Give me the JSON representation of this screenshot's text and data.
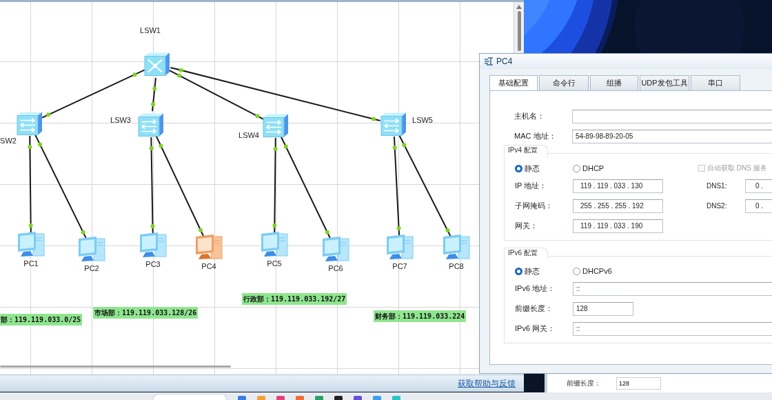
{
  "topology": {
    "switches": [
      {
        "label": "LSW1",
        "kind": "core"
      },
      {
        "label": "SW2",
        "kind": "access"
      },
      {
        "label": "LSW3",
        "kind": "access"
      },
      {
        "label": "LSW4",
        "kind": "access"
      },
      {
        "label": "LSW5",
        "kind": "access"
      }
    ],
    "pcs": [
      {
        "label": "PC1",
        "selected": false
      },
      {
        "label": "PC2",
        "selected": false
      },
      {
        "label": "PC3",
        "selected": false
      },
      {
        "label": "PC4",
        "selected": true
      },
      {
        "label": "PC5",
        "selected": false
      },
      {
        "label": "PC6",
        "selected": false
      },
      {
        "label": "PC7",
        "selected": false
      },
      {
        "label": "PC8",
        "selected": false
      }
    ],
    "subnet_labels": [
      "部：119.119.033.0/25",
      "市场部：119.119.033.128/26",
      "行政部：119.119.033.192/27",
      "财务部：119.119.033.224"
    ]
  },
  "help_link": "获取帮助与反馈",
  "dialog": {
    "title": "PC4",
    "tabs": [
      {
        "label": "基础配置",
        "selected": true
      },
      {
        "label": "命令行",
        "selected": false
      },
      {
        "label": "组播",
        "selected": false
      },
      {
        "label": "UDP发包工具",
        "selected": false
      },
      {
        "label": "串口",
        "selected": false
      }
    ],
    "hostname": {
      "label": "主机名："
    },
    "mac": {
      "label": "MAC 地址：",
      "value": "54-89-98-89-20-05"
    },
    "ipv4": {
      "title": "IPv4 配置",
      "modes": [
        {
          "label": "静态",
          "selected": true
        },
        {
          "label": "DHCP",
          "selected": false
        }
      ],
      "auto_dns": {
        "label": "自动获取 DNS 服务",
        "checked": false,
        "disabled": true
      },
      "fields": [
        {
          "label": "IP 地址：",
          "value": "119 . 119 . 033 . 130"
        },
        {
          "label": "子网掩码：",
          "value": "255 . 255 . 255 . 192"
        },
        {
          "label": "网关：",
          "value": "119 . 119 . 033 . 190"
        }
      ],
      "dns": [
        {
          "label": "DNS1:",
          "value": "0 ."
        },
        {
          "label": "DNS2:",
          "value": "0 ."
        }
      ]
    },
    "ipv6": {
      "title": "IPv6 配置",
      "modes": [
        {
          "label": "静态",
          "selected": true
        },
        {
          "label": "DHCPv6",
          "selected": false
        }
      ],
      "fields": [
        {
          "label": "IPv6 地址：",
          "value": "::",
          "kind": "wide"
        },
        {
          "label": "前缀长度：",
          "value": "128",
          "kind": "short"
        },
        {
          "label": "IPv6 网关：",
          "value": "::",
          "kind": "wide"
        }
      ]
    }
  },
  "background_window": {
    "label": "前缀长度：",
    "value": "128"
  }
}
